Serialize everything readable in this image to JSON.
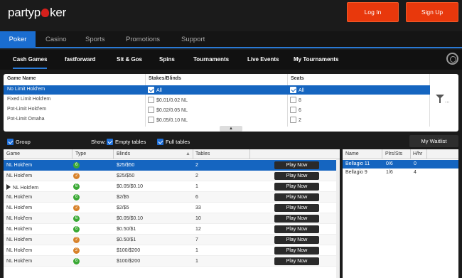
{
  "brand": {
    "logo": "partypoker"
  },
  "header": {
    "login": "Log In",
    "signup": "Sign Up"
  },
  "mainnav": [
    "Poker",
    "Casino",
    "Sports",
    "Promotions",
    "Support"
  ],
  "subnav": [
    "Cash Games",
    "fastforward",
    "Sit & Gos",
    "Spins",
    "Tournaments",
    "Live Events",
    "My Tournaments"
  ],
  "filter": {
    "headers": [
      "Game Name",
      "Stakes/Blinds",
      "Seats"
    ],
    "games": [
      "No Limit Hold'em",
      "Fixed Limit Hold'em",
      "Pot-Limit Hold'em",
      "Pot-Limit Omaha"
    ],
    "stakes": [
      "All",
      "$0.01/0.02 NL",
      "$0.02/0.05 NL",
      "$0.05/0.10 NL"
    ],
    "seats": [
      "All",
      "8",
      "6",
      "2"
    ]
  },
  "options": {
    "group": "Group",
    "show": "Show:",
    "empty": "Empty tables",
    "full": "Full tables",
    "waitlist": "My Waitlist"
  },
  "table": {
    "headers": [
      "Game",
      "Type",
      "Blinds",
      "Tables"
    ],
    "play_label": "Play Now",
    "rows": [
      {
        "game": "NL Hold'em",
        "type": "6",
        "blinds": "$25/$50",
        "tables": "2",
        "type_color": "#3aa935"
      },
      {
        "game": "NL Hold'em",
        "type": "2",
        "blinds": "$25/$50",
        "tables": "2",
        "type_color": "#d8822a"
      },
      {
        "game": "NL Hold'em",
        "type": "6",
        "blinds": "$0.05/$0.10",
        "tables": "1",
        "type_color": "#3aa935"
      },
      {
        "game": "NL Hold'em",
        "type": "6",
        "blinds": "$2/$5",
        "tables": "6",
        "type_color": "#3aa935"
      },
      {
        "game": "NL Hold'em",
        "type": "2",
        "blinds": "$2/$5",
        "tables": "33",
        "type_color": "#d8822a"
      },
      {
        "game": "NL Hold'em",
        "type": "6",
        "blinds": "$0.05/$0.10",
        "tables": "10",
        "type_color": "#3aa935"
      },
      {
        "game": "NL Hold'em",
        "type": "6",
        "blinds": "$0.50/$1",
        "tables": "12",
        "type_color": "#3aa935"
      },
      {
        "game": "NL Hold'em",
        "type": "2",
        "blinds": "$0.50/$1",
        "tables": "7",
        "type_color": "#d8822a"
      },
      {
        "game": "NL Hold'em",
        "type": "2",
        "blinds": "$100/$200",
        "tables": "1",
        "type_color": "#d8822a"
      },
      {
        "game": "NL Hold'em",
        "type": "6",
        "blinds": "$100/$200",
        "tables": "1",
        "type_color": "#3aa935"
      }
    ]
  },
  "tableslist": {
    "headers": [
      "Name",
      "Plrs/Sts",
      "H/hr"
    ],
    "rows": [
      {
        "name": "Bellagio 11",
        "plrs": "0/6",
        "hhr": "0"
      },
      {
        "name": "Bellagio 9",
        "plrs": "1/6",
        "hhr": "4"
      }
    ]
  },
  "colors": {
    "accent": "#e8380c",
    "selected": "#1565c0",
    "nav_active": "#1a6dd0"
  }
}
